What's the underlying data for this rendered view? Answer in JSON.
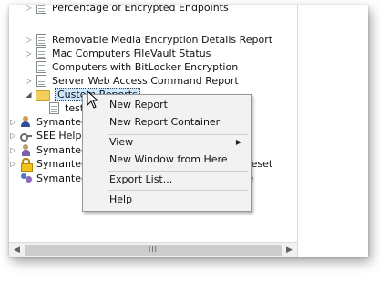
{
  "tree": {
    "items": [
      {
        "label": "Percentage of Encrypted Endpoints",
        "icon": "document-icon",
        "expander": "▷"
      },
      {
        "label": "Removable Media Encryption Details Report",
        "icon": "document-icon",
        "expander": "▷"
      },
      {
        "label": "Mac Computers FileVault Status",
        "icon": "document-icon",
        "expander": "▷"
      },
      {
        "label": "Computers with BitLocker Encryption",
        "icon": "document-icon",
        "expander": ""
      },
      {
        "label": "Server Web Access Command Report",
        "icon": "document-icon",
        "expander": "▷"
      },
      {
        "label": "Custom Reports",
        "icon": "folder-icon",
        "expander": "◢"
      },
      {
        "label": "test",
        "icon": "document-icon",
        "expander": ""
      },
      {
        "label": "Symantec Endpoint Protection",
        "icon": "user-icon",
        "expander": "▷"
      },
      {
        "label": "SEE Help Desk",
        "icon": "key-icon",
        "expander": "▷"
      },
      {
        "label": "Symantec Endpoint Encryption",
        "icon": "person-icon",
        "expander": "▷"
      },
      {
        "label": "Symantec Endpoint Encryption Password Reset",
        "icon": "lock-icon",
        "expander": "▷"
      },
      {
        "label": "Symantec Endpoint Encryption Compliance",
        "icon": "people-icon",
        "expander": ""
      }
    ]
  },
  "context_menu": {
    "items": [
      {
        "label": "New Report"
      },
      {
        "label": "New Report Container"
      },
      {
        "label": "View",
        "submenu_arrow": "▶"
      },
      {
        "label": "New Window from Here"
      },
      {
        "label": "Export List..."
      },
      {
        "label": "Help"
      }
    ]
  },
  "scrollbar": {
    "left_arrow": "◀",
    "right_arrow": "▶",
    "grip": "III"
  }
}
